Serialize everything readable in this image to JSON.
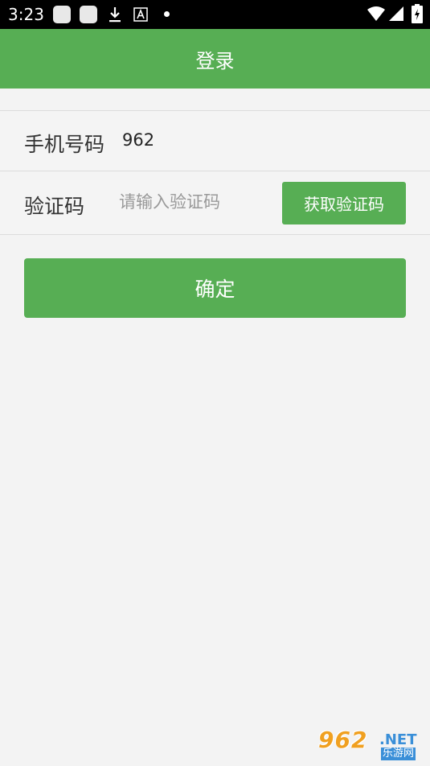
{
  "status_bar": {
    "time": "3:23"
  },
  "app_bar": {
    "title": "登录"
  },
  "form": {
    "phone_label": "手机号码",
    "phone_value": "962",
    "code_label": "验证码",
    "code_placeholder": "请输入验证码",
    "code_value": "",
    "get_code_button": "获取验证码"
  },
  "confirm_button": "确定",
  "watermark": {
    "number": "962",
    "suffix": ".NET",
    "name": "乐游网"
  },
  "colors": {
    "accent": "#57ae54",
    "background": "#f3f3f3"
  }
}
